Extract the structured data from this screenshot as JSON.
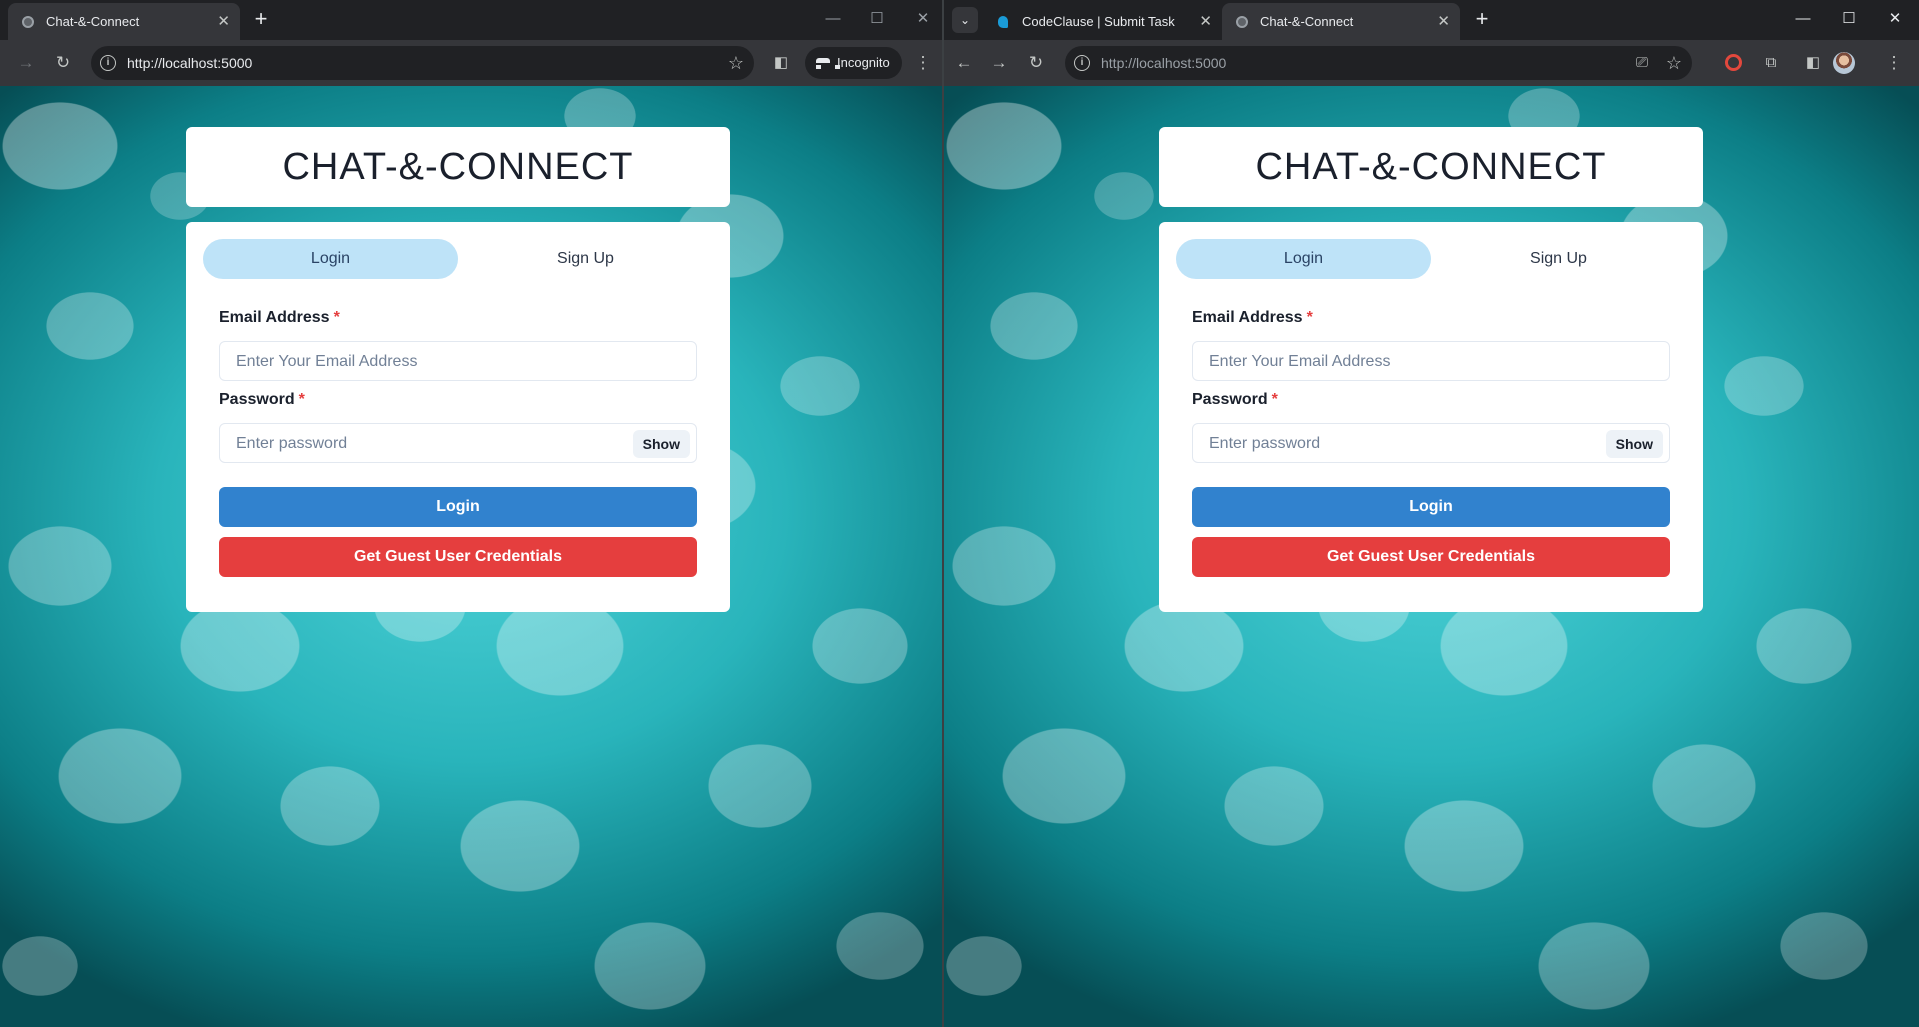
{
  "app": {
    "title": "Chat-&-Connect"
  },
  "left_window": {
    "tabs": [
      {
        "label": "Chat-&-Connect",
        "active": true
      }
    ],
    "new_tab": "+",
    "url": "http://localhost:5000",
    "incognito_label": "Incognito",
    "window_controls": {
      "minimize": "—",
      "maximize": "☐",
      "close": "✕"
    }
  },
  "right_window": {
    "tabs": [
      {
        "label": "CodeClause | Submit Task",
        "active": false
      },
      {
        "label": "Chat-&-Connect",
        "active": true
      }
    ],
    "new_tab": "+",
    "url_host": "http://localhost",
    "url_port": ":5000",
    "window_controls": {
      "minimize": "—",
      "maximize": "☐",
      "close": "✕"
    }
  },
  "page": {
    "heading": "CHAT-&-CONNECT",
    "tabs": {
      "login": "Login",
      "signup": "Sign Up"
    },
    "selected_tab": "login",
    "email": {
      "label": "Email Address",
      "required_mark": "*",
      "placeholder": "Enter Your Email Address"
    },
    "password": {
      "label": "Password",
      "required_mark": "*",
      "placeholder": "Enter password",
      "toggle": "Show"
    },
    "login_button": "Login",
    "guest_button": "Get Guest User Credentials"
  },
  "icons": {
    "back": "back-arrow-icon",
    "forward": "forward-arrow-icon",
    "reload": "reload-icon",
    "info": "site-info-icon",
    "star": "bookmark-star-icon",
    "side_panel": "side-panel-icon",
    "incognito": "incognito-icon",
    "menu": "kebab-menu-icon",
    "install": "install-app-icon",
    "extensions": "puzzle-extensions-icon",
    "profile": "profile-avatar-icon"
  },
  "colors": {
    "login_button": "#3182ce",
    "guest_button": "#e53e3e",
    "selected_tab": "#bee3f8",
    "required": "#e53e3e"
  }
}
